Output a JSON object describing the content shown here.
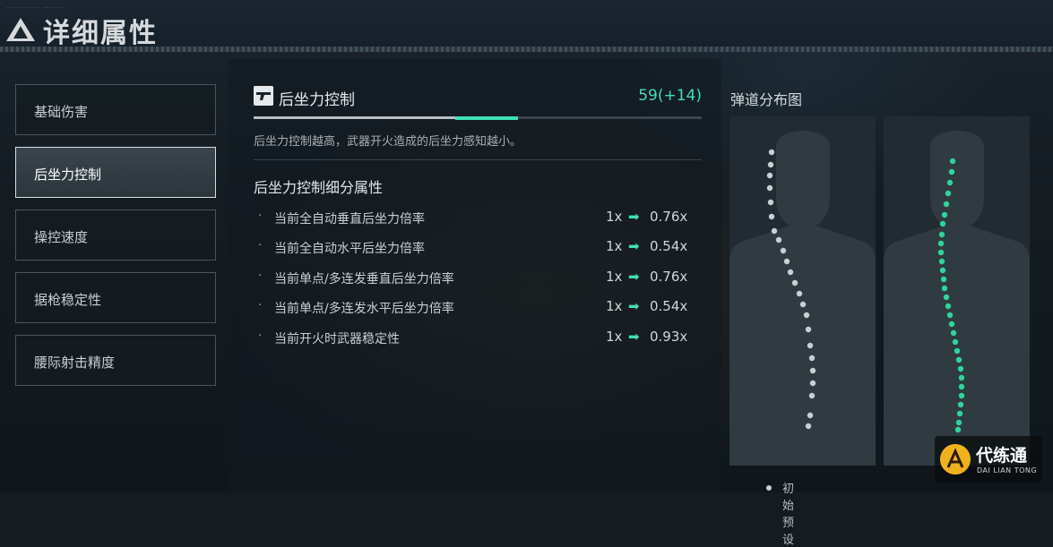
{
  "header": {
    "title": "详细属性",
    "tiny_caption": "............ ........"
  },
  "menu": {
    "items": [
      {
        "label": "基础伤害",
        "active": false
      },
      {
        "label": "后坐力控制",
        "active": true
      },
      {
        "label": "操控速度",
        "active": false
      },
      {
        "label": "据枪稳定性",
        "active": false
      },
      {
        "label": "腰际射击精度",
        "active": false
      }
    ]
  },
  "detail": {
    "icon": "rifle-icon",
    "title": "后坐力控制",
    "value": "59(+14)",
    "base_fraction": 0.45,
    "bonus_fraction": 0.14,
    "description": "后坐力控制越高，武器开火造成的后坐力感知越小。",
    "sub_title": "后坐力控制细分属性",
    "attributes": [
      {
        "bullet": "·",
        "name": "当前全自动垂直后坐力倍率",
        "from": "1x",
        "to": "0.76x"
      },
      {
        "bullet": "·",
        "name": "当前全自动水平后坐力倍率",
        "from": "1x",
        "to": "0.54x"
      },
      {
        "bullet": "·",
        "name": "当前单点/多连发垂直后坐力倍率",
        "from": "1x",
        "to": "0.76x"
      },
      {
        "bullet": "·",
        "name": "当前单点/多连发水平后坐力倍率",
        "from": "1x",
        "to": "0.54x"
      },
      {
        "bullet": "·",
        "name": "当前开火时武器稳定性",
        "from": "1x",
        "to": "0.93x"
      }
    ]
  },
  "ballistics": {
    "title": "弹道分布图",
    "legend_label": "初始预设",
    "colors": {
      "initial": "#c9cfd3",
      "current": "#2fd49a"
    }
  },
  "colors": {
    "accent": "#3fe0b6",
    "background": "#141c22"
  },
  "watermark": {
    "main": "代练通",
    "sub": "DAI LIAN TONG"
  }
}
